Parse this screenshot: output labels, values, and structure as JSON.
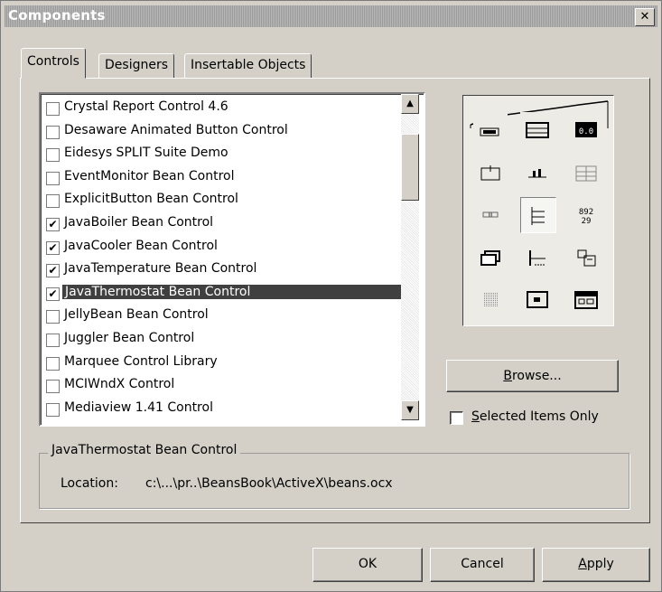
{
  "window": {
    "title": "Components",
    "close_glyph": "✕"
  },
  "tabs": [
    {
      "label": "Controls",
      "active": true
    },
    {
      "label": "Designers",
      "active": false
    },
    {
      "label": "Insertable Objects",
      "active": false
    }
  ],
  "controls_list": [
    {
      "label": "Crystal Report Control 4.6",
      "checked": false,
      "selected": false
    },
    {
      "label": "Desaware Animated Button Control",
      "checked": false,
      "selected": false
    },
    {
      "label": "Eidesys SPLIT Suite Demo",
      "checked": false,
      "selected": false
    },
    {
      "label": "EventMonitor Bean Control",
      "checked": false,
      "selected": false
    },
    {
      "label": "ExplicitButton Bean Control",
      "checked": false,
      "selected": false
    },
    {
      "label": "JavaBoiler Bean Control",
      "checked": true,
      "selected": false
    },
    {
      "label": "JavaCooler Bean Control",
      "checked": true,
      "selected": false
    },
    {
      "label": "JavaTemperature Bean Control",
      "checked": true,
      "selected": false
    },
    {
      "label": "JavaThermostat Bean Control",
      "checked": true,
      "selected": true
    },
    {
      "label": "JellyBean Bean Control",
      "checked": false,
      "selected": false
    },
    {
      "label": "Juggler Bean Control",
      "checked": false,
      "selected": false
    },
    {
      "label": "Marquee Control Library",
      "checked": false,
      "selected": false
    },
    {
      "label": "MCIWndX Control",
      "checked": false,
      "selected": false
    },
    {
      "label": "Mediaview 1.41 Control",
      "checked": false,
      "selected": false
    }
  ],
  "scroll": {
    "up_glyph": "▲",
    "down_glyph": "▼"
  },
  "palette": {
    "icons": [
      "frame-icon",
      "listbox-icon",
      "digital-display-icon",
      "label-icon",
      "meter-icon",
      "grid-icon",
      "small-button-icon",
      "treeview-icon",
      "slider-grid-icon",
      "window-icon",
      "tree-icon",
      "boxes-icon",
      "dots-icon",
      "picture-icon",
      "panel-icon"
    ],
    "pressed_index": 7,
    "icon_color": "#000000"
  },
  "browse": {
    "label": "Browse...",
    "mnemonic": "B",
    "rest": "rowse..."
  },
  "selected_items_only": {
    "label": "Selected Items Only",
    "mnemonic": "S",
    "rest": "elected Items Only",
    "checked": false
  },
  "details": {
    "group_title": "JavaThermostat Bean Control",
    "location_label": "Location:",
    "location_value": "c:\\...\\pr..\\BeansBook\\ActiveX\\beans.ocx"
  },
  "buttons": {
    "ok": "OK",
    "cancel": "Cancel",
    "apply": {
      "label": "Apply",
      "mnemonic": "A",
      "rest": "pply"
    }
  }
}
